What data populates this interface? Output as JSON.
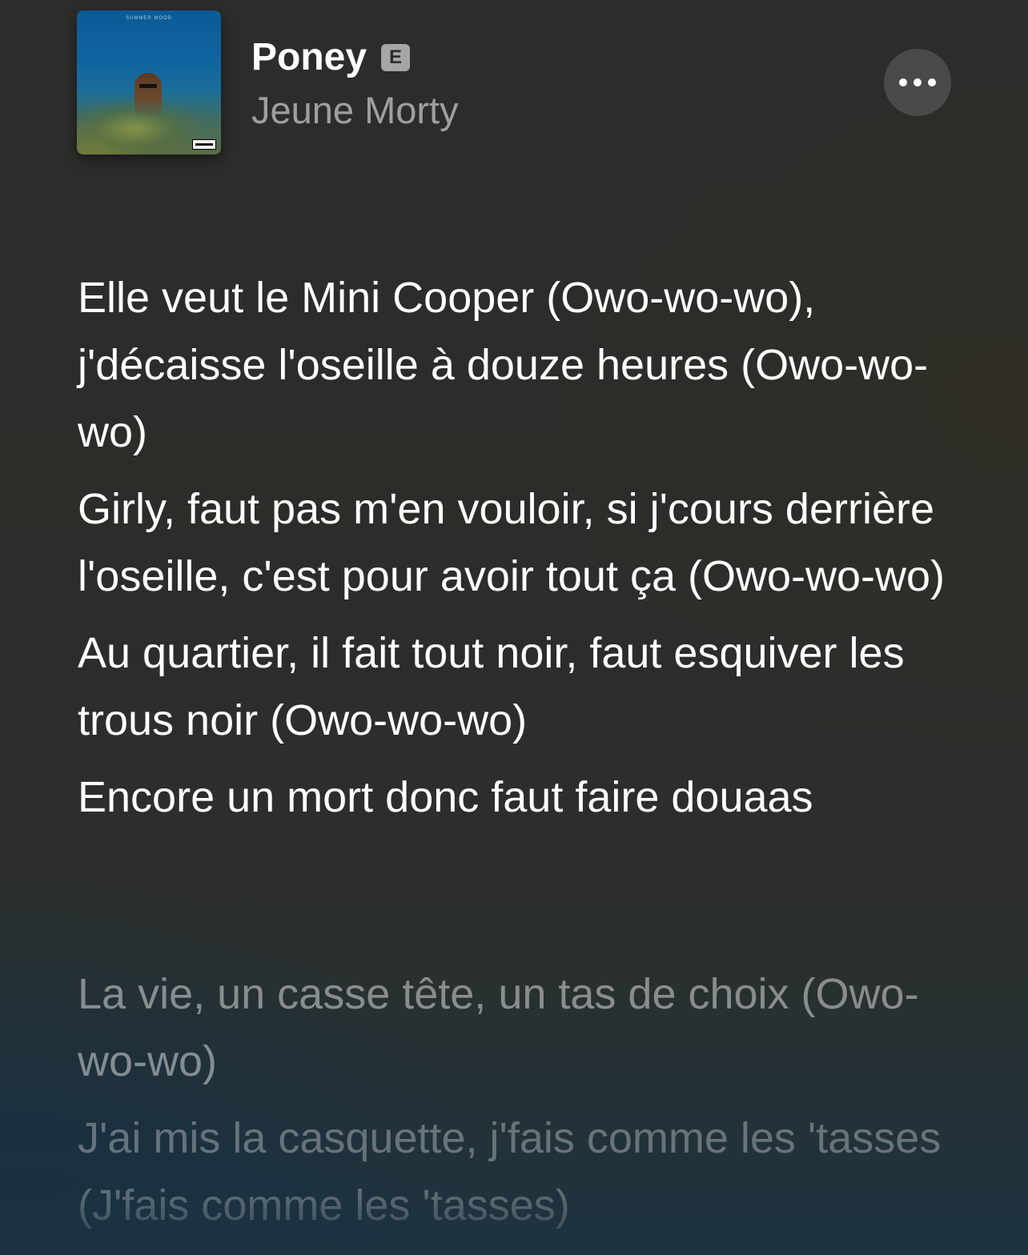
{
  "now_playing": {
    "title": "Poney",
    "explicit_badge": "E",
    "artist": "Jeune Morty",
    "artwork": {
      "cover_text": "SUMMER MOOD",
      "advisory_label": "PARENTAL ADVISORY EXPLICIT CONTENT"
    },
    "more_icon": "ellipsis-icon"
  },
  "lyrics": {
    "current_block": [
      "Elle veut le Mini Cooper (Owo-wo-wo), j'décaisse l'oseille à douze heures (Owo-wo-wo)",
      "Girly, faut pas m'en vouloir, si j'cours derrière l'oseille, c'est pour avoir tout ça (Owo-wo-wo)",
      "Au quartier, il fait tout noir, faut esquiver les trous noir  (Owo-wo-wo)",
      "Encore un mort donc faut faire douaas"
    ],
    "upcoming_block": [
      "La vie, un casse tête, un tas de choix (Owo-wo-wo)",
      "J'ai mis la casquette, j'fais comme les 'tasses (J'fais comme les 'tasses)"
    ]
  }
}
